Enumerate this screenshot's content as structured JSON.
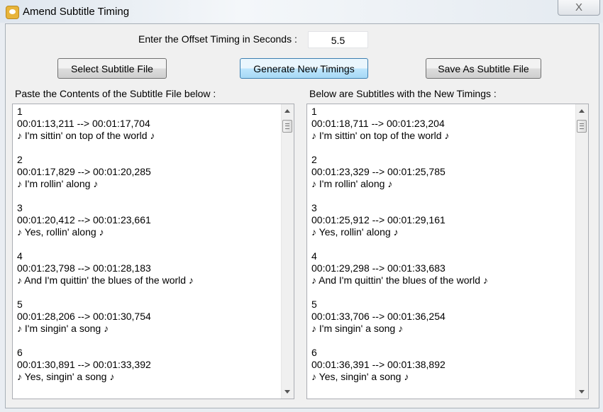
{
  "window": {
    "title": "Amend Subtitle Timing",
    "close_label": "X"
  },
  "offset": {
    "label": "Enter the Offset Timing in Seconds :",
    "value": "5.5"
  },
  "buttons": {
    "select": "Select Subtitle File",
    "generate": "Generate New Timings",
    "save": "Save As Subtitle File"
  },
  "left": {
    "label": "Paste the Contents of the Subtitle File below :",
    "lines": [
      "1",
      "00:01:13,211 --> 00:01:17,704",
      "♪ I'm sittin' on top of the world ♪",
      "",
      "2",
      "00:01:17,829 --> 00:01:20,285",
      "♪ I'm rollin' along ♪",
      "",
      "3",
      "00:01:20,412 --> 00:01:23,661",
      "♪ Yes, rollin' along ♪",
      "",
      "4",
      "00:01:23,798 --> 00:01:28,183",
      "♪ And I'm quittin' the blues of the world ♪",
      "",
      "5",
      "00:01:28,206 --> 00:01:30,754",
      "♪ I'm singin' a song ♪",
      "",
      "6",
      "00:01:30,891 --> 00:01:33,392",
      "♪ Yes, singin' a song ♪"
    ]
  },
  "right": {
    "label": "Below are Subtitles with the New Timings :",
    "lines": [
      "1",
      "00:01:18,711 --> 00:01:23,204",
      "♪ I'm sittin' on top of the world ♪",
      "",
      "2",
      "00:01:23,329 --> 00:01:25,785",
      "♪ I'm rollin' along ♪",
      "",
      "3",
      "00:01:25,912 --> 00:01:29,161",
      "♪ Yes, rollin' along ♪",
      "",
      "4",
      "00:01:29,298 --> 00:01:33,683",
      "♪ And I'm quittin' the blues of the world ♪",
      "",
      "5",
      "00:01:33,706 --> 00:01:36,254",
      "♪ I'm singin' a song ♪",
      "",
      "6",
      "00:01:36,391 --> 00:01:38,892",
      "♪ Yes, singin' a song ♪"
    ]
  }
}
